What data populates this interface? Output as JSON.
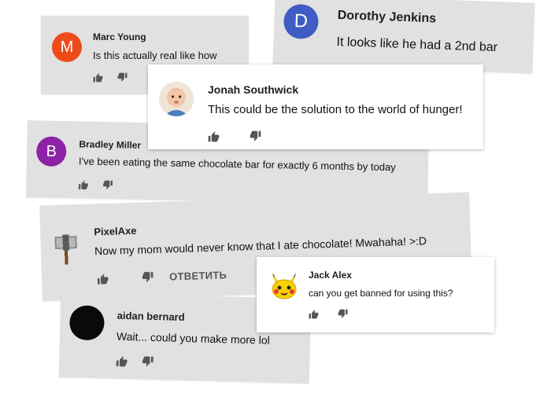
{
  "comments": [
    {
      "author": "Marc Young",
      "avatar_letter": "M",
      "avatar_color": "#ee4b1a",
      "text": "Is this actually real like how"
    },
    {
      "author": "Dorothy Jenkins",
      "avatar_letter": "D",
      "avatar_color": "#3f5bc4",
      "text": "It looks like he had a 2nd bar"
    },
    {
      "author": "Jonah Southwick",
      "avatar_kind": "baby-photo",
      "text": "This could be the solution to the world of hunger!"
    },
    {
      "author": "Bradley Miller",
      "avatar_letter": "B",
      "avatar_color": "#8e22a6",
      "text": "I've been eating the same chocolate bar for exactly 6 months by today"
    },
    {
      "author": "PixelAxe",
      "avatar_kind": "pixel-axe",
      "text": "Now my mom would never know that I ate chocolate! Mwahaha! >:D",
      "reply_label": "ОТВЕТИТЬ"
    },
    {
      "author": "Jack Alex",
      "avatar_kind": "pikachu",
      "text": "can you get banned for using this?"
    },
    {
      "author": "aidan bernard",
      "avatar_kind": "black-circle",
      "avatar_color": "#0a0a0a",
      "text": "Wait... could you make more lol"
    }
  ],
  "colors": {
    "card_gray": "#e1e1e1",
    "card_white": "#ffffff",
    "icon": "#555555"
  },
  "icons": {
    "like": "thumbs-up-icon",
    "dislike": "thumbs-down-icon"
  }
}
